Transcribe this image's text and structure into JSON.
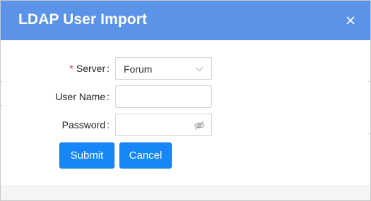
{
  "dialog": {
    "title": "LDAP User Import",
    "close_icon": "close-icon",
    "header_color": "#5a93e8"
  },
  "form": {
    "server": {
      "required_mark": "*",
      "label": "Server",
      "colon": ":",
      "value": "Forum",
      "icon": "chevron-down-icon"
    },
    "username": {
      "label": "User Name",
      "colon": ":",
      "value": ""
    },
    "password": {
      "label": "Password",
      "colon": ":",
      "value": "",
      "icon": "eye-hidden-icon"
    }
  },
  "buttons": {
    "submit": "Submit",
    "cancel": "Cancel",
    "color": "#1787f8"
  }
}
